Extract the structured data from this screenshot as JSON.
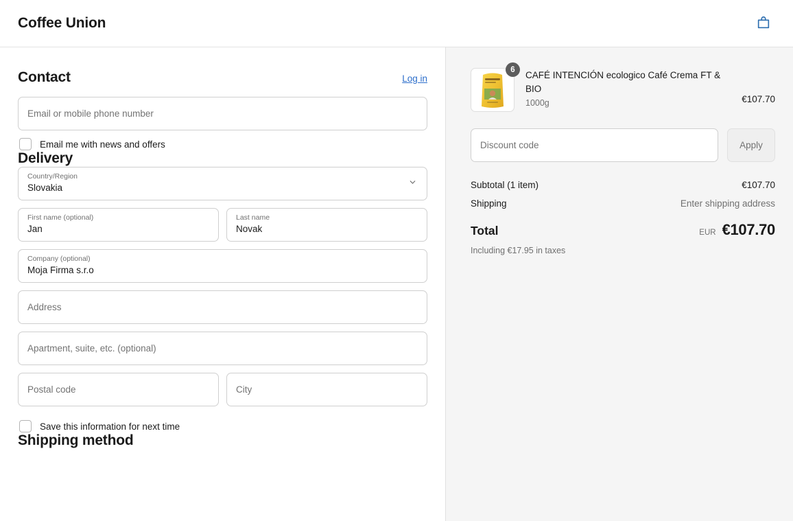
{
  "header": {
    "shop_name": "Coffee Union",
    "cart_icon": "shopping-bag-icon"
  },
  "contact": {
    "title": "Contact",
    "login_label": "Log in",
    "email_placeholder": "Email or mobile phone number",
    "email_value": "",
    "newsletter_label": "Email me with news and offers",
    "newsletter_checked": false
  },
  "delivery": {
    "title": "Delivery",
    "country": {
      "label": "Country/Region",
      "value": "Slovakia",
      "chevron_icon": "chevron-down-icon"
    },
    "first_name": {
      "label": "First name (optional)",
      "value": "Jan"
    },
    "last_name": {
      "label": "Last name",
      "value": "Novak"
    },
    "company": {
      "label": "Company (optional)",
      "value": "Moja Firma s.r.o"
    },
    "address": {
      "placeholder": "Address",
      "value": ""
    },
    "apartment": {
      "placeholder": "Apartment, suite, etc. (optional)",
      "value": ""
    },
    "postal_code": {
      "placeholder": "Postal code",
      "value": ""
    },
    "city": {
      "placeholder": "City",
      "value": ""
    },
    "save_info_label": "Save this information for next time",
    "save_info_checked": false
  },
  "shipping_method": {
    "title": "Shipping method"
  },
  "summary": {
    "item": {
      "quantity_badge": "6",
      "title": "CAFÉ INTENCIÓN ecologico Café Crema FT & BIO",
      "variant": "1000g",
      "price": "€107.70",
      "thumbnail_icon": "coffee-bag-image"
    },
    "discount": {
      "placeholder": "Discount code",
      "value": "",
      "apply_label": "Apply"
    },
    "subtotal_label": "Subtotal (1 item)",
    "subtotal_value": "€107.70",
    "shipping_label": "Shipping",
    "shipping_value": "Enter shipping address",
    "total_label": "Total",
    "currency": "EUR",
    "total_value": "€107.70",
    "taxes_note": "Including €17.95 in taxes"
  },
  "colors": {
    "link": "#2c6ecb",
    "panel_bg": "#f5f5f5",
    "badge_bg": "#5c5c5c",
    "cart_icon": "#2e6fb0"
  }
}
